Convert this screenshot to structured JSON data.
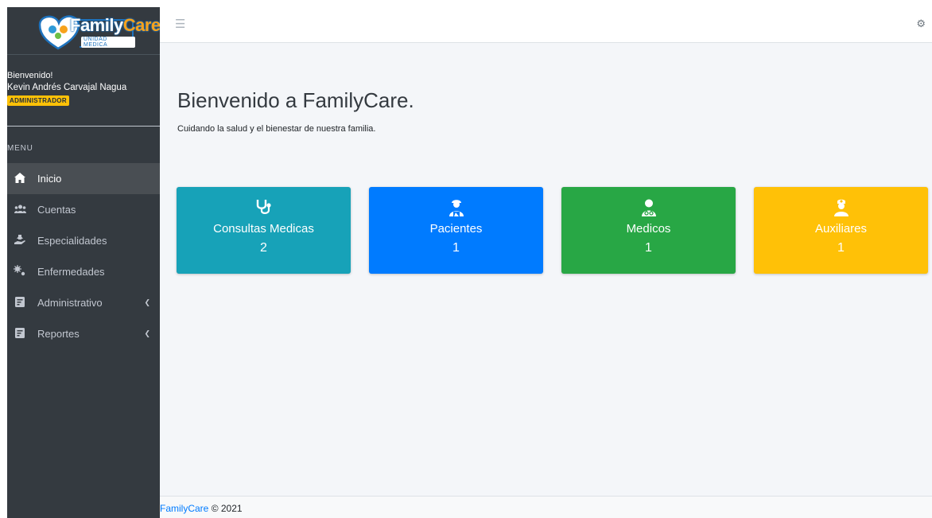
{
  "brand": {
    "logo_text_1": "Family",
    "logo_text_2": "Care",
    "logo_subtitle": "UNIDAD MEDICA"
  },
  "user": {
    "greeting": "Bienvenido!",
    "name": "Kevin Andrés Carvajal Nagua",
    "role": "ADMINISTRADOR"
  },
  "sidebar": {
    "menu_header": "MENU",
    "items": [
      {
        "label": "Inicio",
        "icon": "home-icon",
        "active": true
      },
      {
        "label": "Cuentas",
        "icon": "users-icon",
        "active": false
      },
      {
        "label": "Especialidades",
        "icon": "hand-holding-icon",
        "active": false
      },
      {
        "label": "Enfermedades",
        "icon": "viruses-icon",
        "active": false
      },
      {
        "label": "Administrativo",
        "icon": "file-icon",
        "active": false,
        "has_submenu": true
      },
      {
        "label": "Reportes",
        "icon": "file-icon",
        "active": false,
        "has_submenu": true
      }
    ]
  },
  "header": {
    "menu_icon": "hamburger-icon",
    "settings_icon": "gear-icon"
  },
  "main": {
    "title": "Bienvenido a FamilyCare.",
    "subtitle": "Cuidando la salud y el bienestar de nuestra familia.",
    "cards": [
      {
        "label": "Consultas Medicas",
        "value": "2",
        "icon": "stethoscope-icon",
        "color": "#17a2b8"
      },
      {
        "label": "Pacientes",
        "value": "1",
        "icon": "patient-icon",
        "color": "#007bff"
      },
      {
        "label": "Medicos",
        "value": "1",
        "icon": "doctor-icon",
        "color": "#28a745"
      },
      {
        "label": "Auxiliares",
        "value": "1",
        "icon": "nurse-icon",
        "color": "#ffc107"
      }
    ]
  },
  "footer": {
    "brand": "FamilyCare",
    "copyright": "© 2021"
  },
  "colors": {
    "sidebar_bg": "#343a40",
    "content_bg": "#f4f6f9",
    "badge": "#ffc107",
    "link": "#007bff"
  }
}
